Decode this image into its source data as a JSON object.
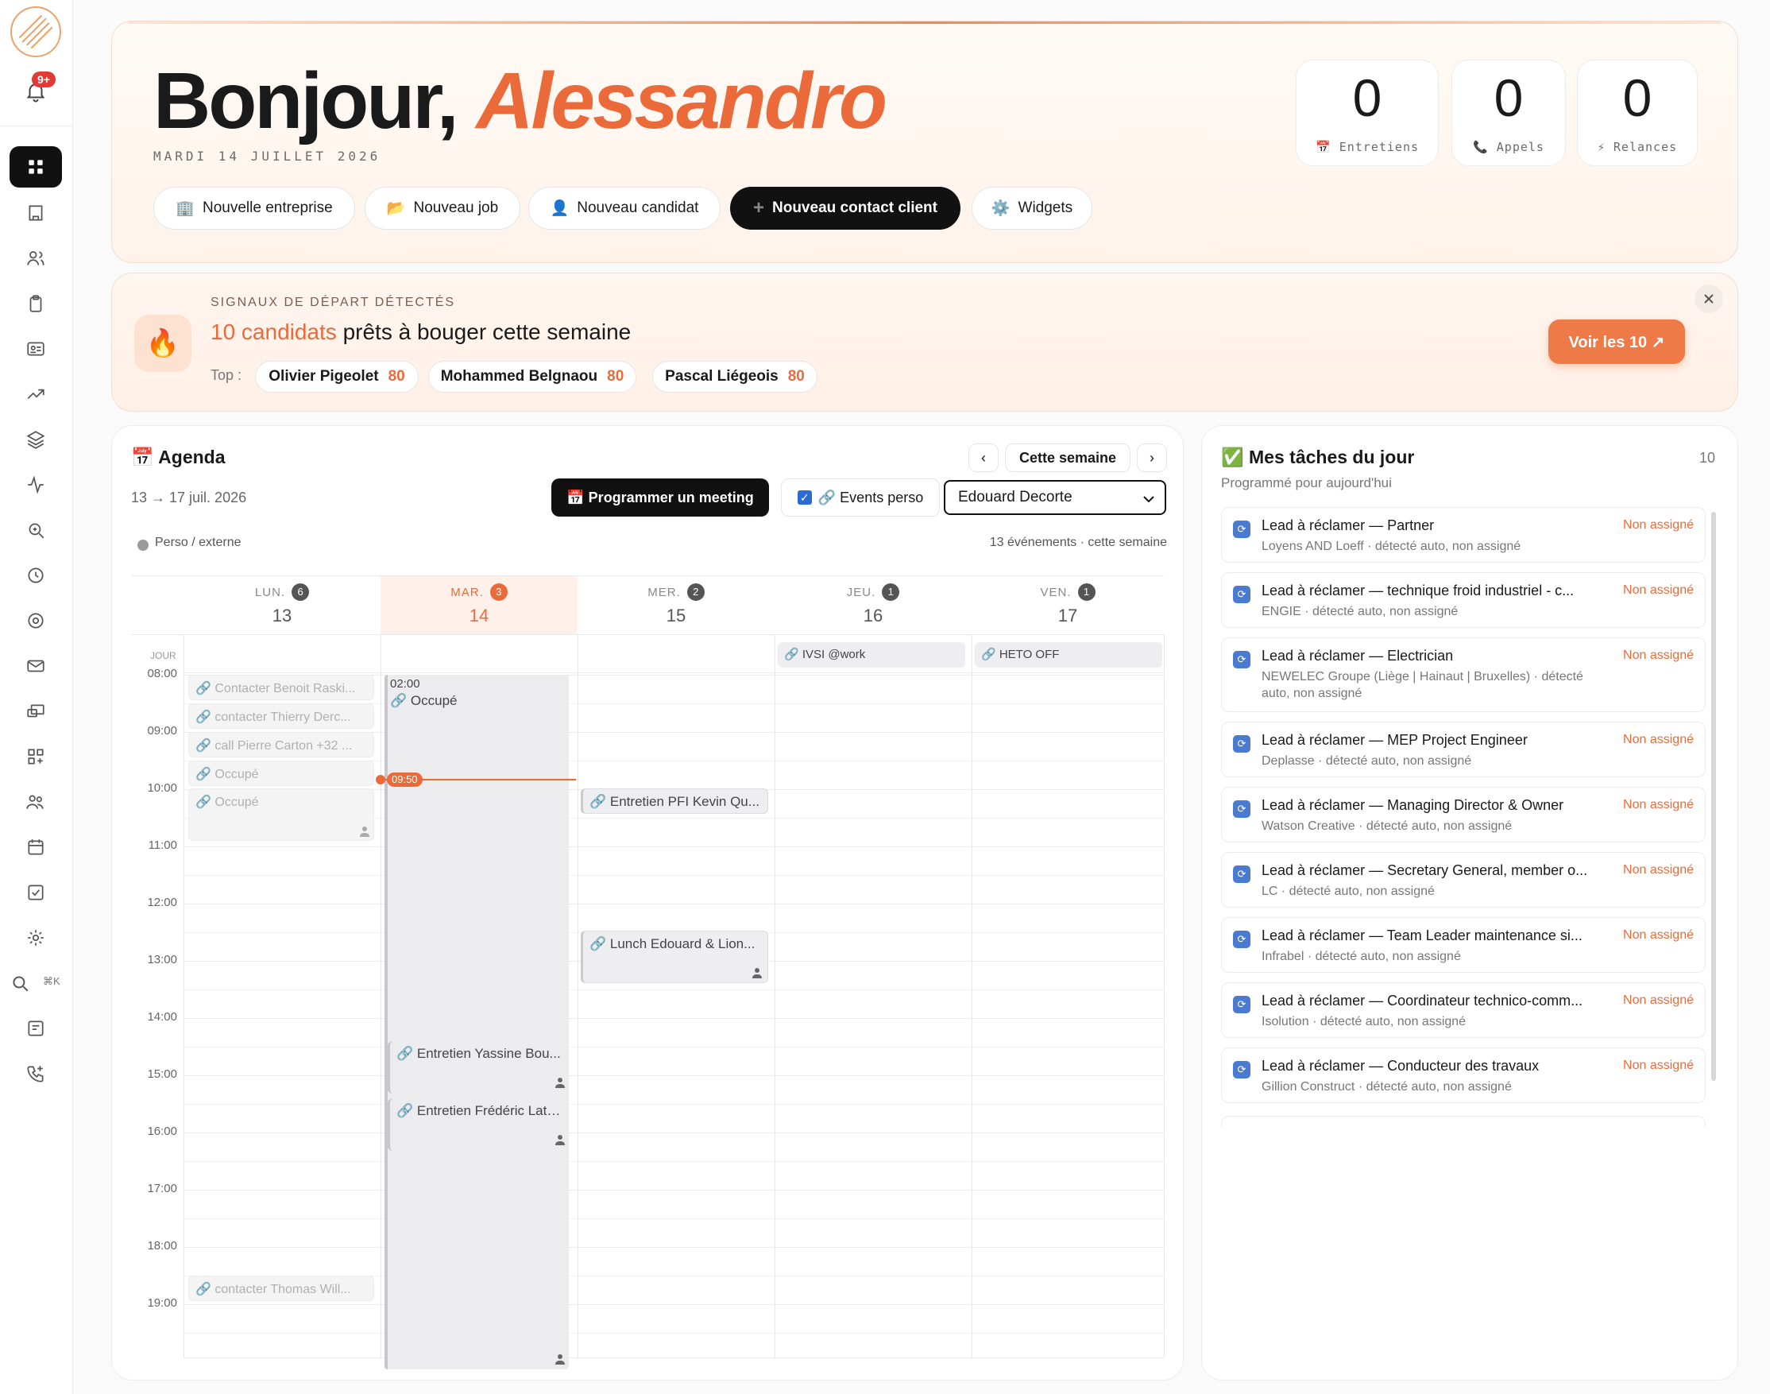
{
  "sidebar": {
    "notification_badge": "9+",
    "search_shortcut": "⌘K",
    "items": [
      "dashboard",
      "companies",
      "candidates",
      "jobs",
      "contacts",
      "analytics",
      "pipelines",
      "activity",
      "search",
      "history",
      "targets",
      "mail",
      "devices",
      "integrations",
      "team",
      "calendar",
      "tasks",
      "settings",
      "search",
      "notes",
      "calls"
    ]
  },
  "hero": {
    "greeting": "Bonjour,",
    "name": "Alessandro",
    "date": "MARDI 14 JUILLET 2026",
    "stats": [
      {
        "value": "0",
        "label": "📅 Entretiens"
      },
      {
        "value": "0",
        "label": "📞 Appels"
      },
      {
        "value": "0",
        "label": "⚡ Relances"
      }
    ],
    "actions": [
      {
        "icon": "🏢",
        "label": "Nouvelle entreprise"
      },
      {
        "icon": "📂",
        "label": "Nouveau job"
      },
      {
        "icon": "👤",
        "label": "Nouveau candidat"
      },
      {
        "icon": "+",
        "label": "Nouveau contact client"
      },
      {
        "icon": "⚙️",
        "label": "Widgets"
      }
    ]
  },
  "signal": {
    "kicker": "SIGNAUX DE DÉPART DÉTECTÉS",
    "highlight": "10 candidats",
    "rest": " prêts à bouger cette semaine",
    "top_label": "Top :",
    "top": [
      {
        "name": "Olivier Pigeolet",
        "score": "80"
      },
      {
        "name": "Mohammed Belgnaou",
        "score": "80"
      },
      {
        "name": "Pascal Liégeois",
        "score": "80"
      }
    ],
    "cta": "Voir les 10 ↗"
  },
  "agenda": {
    "title": "📅 Agenda",
    "range": "13 → 17 juil. 2026",
    "prev": "‹",
    "next": "›",
    "week_btn": "Cette semaine",
    "meeting_btn": "📅 Programmer un meeting",
    "perso_label": "🔗 Events perso",
    "owner": "Edouard Decorte",
    "legend": "Perso / externe",
    "count": "13 événements · cette semaine",
    "jour": "JOUR",
    "days": [
      {
        "name": "LUN.",
        "badge": "6",
        "date": "13"
      },
      {
        "name": "MAR.",
        "badge": "3",
        "date": "14"
      },
      {
        "name": "MER.",
        "badge": "2",
        "date": "15"
      },
      {
        "name": "JEU.",
        "badge": "1",
        "date": "16"
      },
      {
        "name": "VEN.",
        "badge": "1",
        "date": "17"
      }
    ],
    "hours": [
      "08:00",
      "09:00",
      "10:00",
      "11:00",
      "12:00",
      "13:00",
      "14:00",
      "15:00",
      "16:00",
      "17:00",
      "18:00",
      "19:00"
    ],
    "allday": [
      "🔗 IVSI @work",
      "🔗 HETO OFF"
    ],
    "now": "09:50",
    "busy_time": "02:00",
    "events": {
      "mon": [
        "🔗 Contacter Benoit Raski...",
        "🔗 contacter Thierry Derc...",
        "🔗 call Pierre Carton +32 ...",
        "🔗 Occupé",
        "🔗 Occupé",
        "🔗 contacter Thomas Will..."
      ],
      "tue": [
        "🔗 Occupé",
        "🔗 Entretien Yassine Bou...",
        "🔗 Entretien Frédéric Lati..."
      ],
      "wed": [
        "🔗 Entretien PFI Kevin Qu...",
        "🔗 Lunch Edouard & Lion..."
      ]
    }
  },
  "tasks": {
    "title": "✅ Mes tâches du jour",
    "count": "10",
    "subtitle": "Programmé pour aujourd'hui",
    "status": "Non assigné",
    "items": [
      {
        "title": "Lead à réclamer — Partner",
        "sub": "Loyens AND Loeff · détecté auto, non assigné"
      },
      {
        "title": "Lead à réclamer — technique froid industriel - c...",
        "sub": "ENGIE · détecté auto, non assigné"
      },
      {
        "title": "Lead à réclamer — Electrician",
        "sub": "NEWELEC Groupe (Liège | Hainaut | Bruxelles) · détecté auto, non assigné"
      },
      {
        "title": "Lead à réclamer — MEP Project Engineer",
        "sub": "Deplasse · détecté auto, non assigné"
      },
      {
        "title": "Lead à réclamer — Managing Director & Owner",
        "sub": "Watson Creative · détecté auto, non assigné"
      },
      {
        "title": "Lead à réclamer — Secretary General, member o...",
        "sub": "LC · détecté auto, non assigné"
      },
      {
        "title": "Lead à réclamer — Team Leader maintenance si...",
        "sub": "Infrabel · détecté auto, non assigné"
      },
      {
        "title": "Lead à réclamer — Coordinateur technico-comm...",
        "sub": "Isolution · détecté auto, non assigné"
      },
      {
        "title": "Lead à réclamer — Conducteur des travaux",
        "sub": "Gillion Construct · détecté auto, non assigné"
      }
    ]
  },
  "colors": {
    "accent": "#ea6a3a",
    "dark": "#111111"
  }
}
